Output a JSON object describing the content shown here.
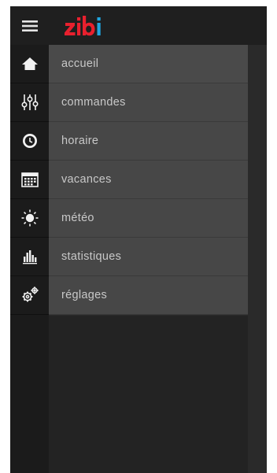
{
  "app": {
    "logo_text": "zibi",
    "colors": {
      "logo_red": "#e8202e",
      "logo_blue": "#1fa6e0"
    }
  },
  "topbar": {
    "menu_icon": "hamburger-icon"
  },
  "menu": {
    "items": [
      {
        "label": "accueil",
        "icon": "home-icon"
      },
      {
        "label": "commandes",
        "icon": "sliders-icon"
      },
      {
        "label": "horaire",
        "icon": "clock-icon"
      },
      {
        "label": "vacances",
        "icon": "calendar-icon"
      },
      {
        "label": "météo",
        "icon": "sun-icon"
      },
      {
        "label": "statistiques",
        "icon": "bar-chart-icon"
      },
      {
        "label": "réglages",
        "icon": "gears-icon"
      }
    ]
  }
}
